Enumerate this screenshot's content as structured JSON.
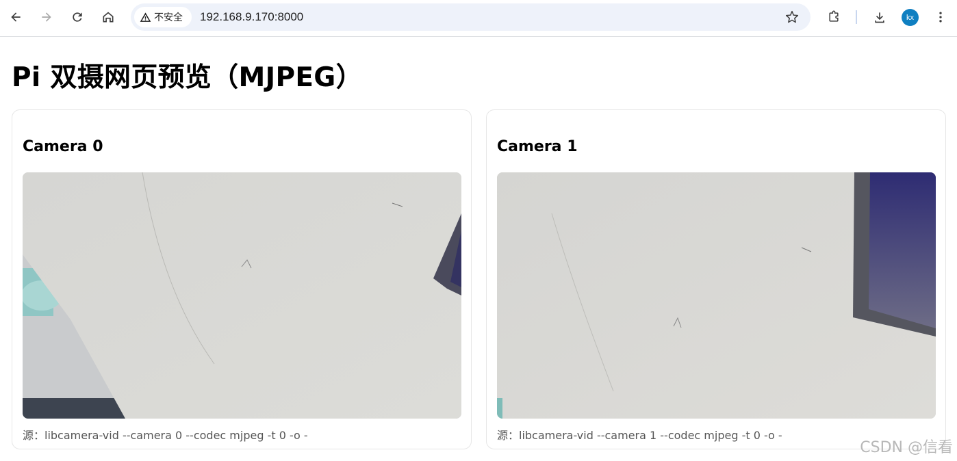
{
  "browser": {
    "security_label": "不安全",
    "url": "192.168.9.170:8000",
    "profile_initials": "kx",
    "icons": [
      "back-icon",
      "forward-icon",
      "reload-icon",
      "home-icon",
      "warning-icon",
      "star-icon",
      "extensions-icon",
      "download-icon",
      "kebab-menu-icon"
    ]
  },
  "page": {
    "title": "Pi 双摄网页预览（MJPEG）"
  },
  "cameras": [
    {
      "title": "Camera 0",
      "source": "源：libcamera-vid --camera 0 --codec mjpeg -t 0 -o -"
    },
    {
      "title": "Camera 1",
      "source": "源：libcamera-vid --camera 1 --codec mjpeg -t 0 -o -"
    }
  ],
  "watermark": "CSDN @信看",
  "colors": {
    "avatar_bg": "#0f7fc1",
    "omnibox_bg": "#eef2fa",
    "wall": "#d8d8d4",
    "monitor": "#3b3a6e"
  }
}
